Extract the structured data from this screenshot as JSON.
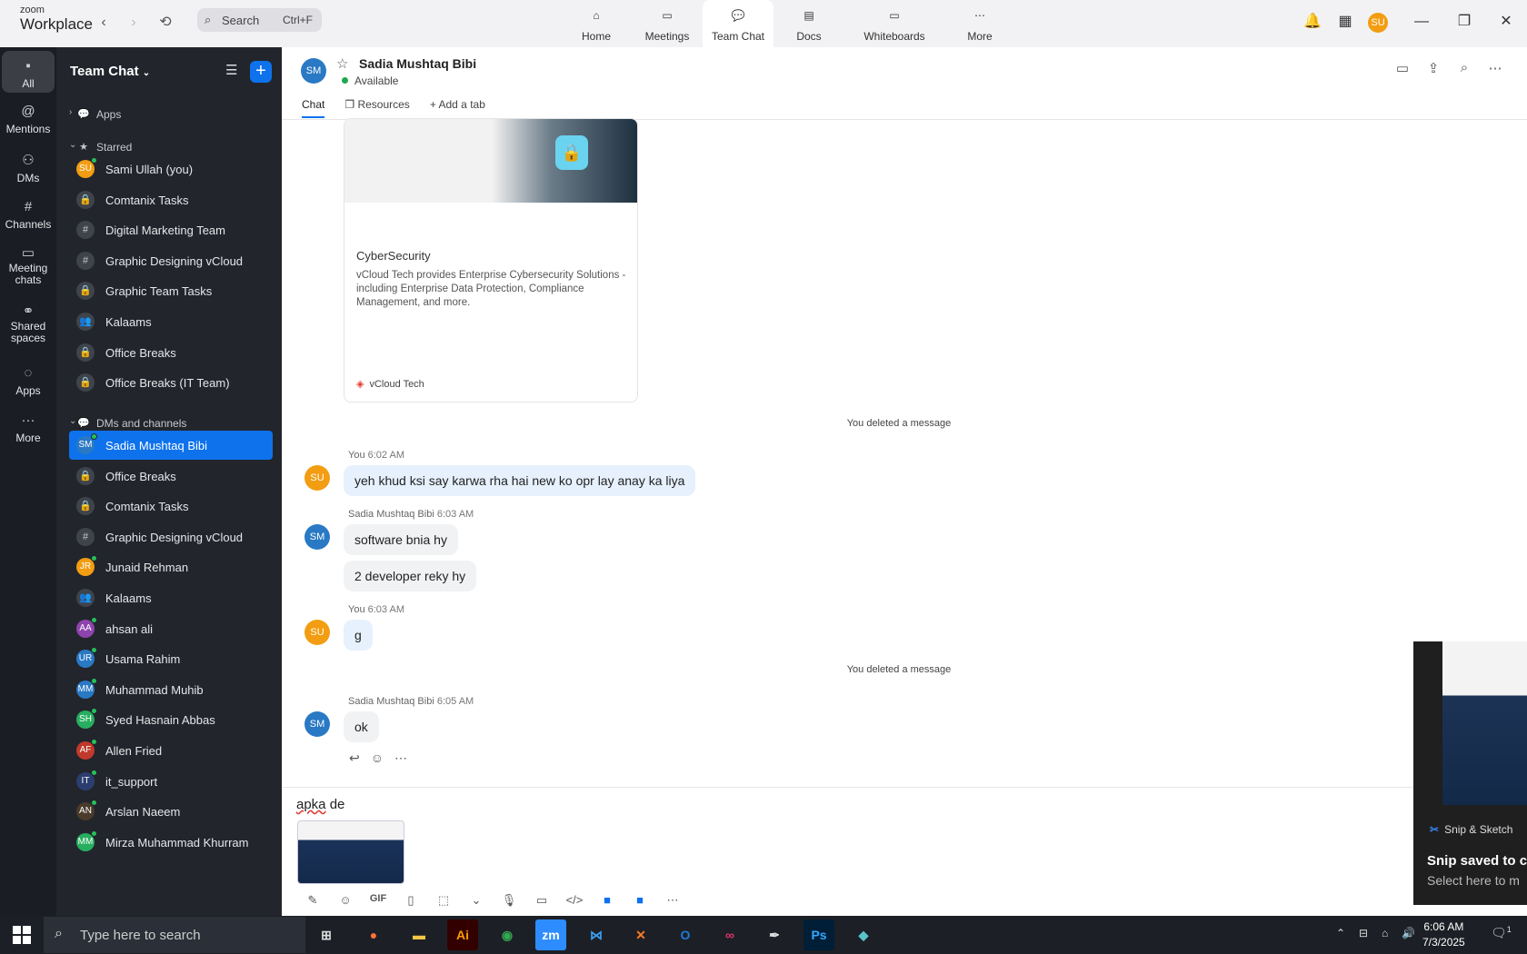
{
  "app": {
    "brand_small": "zoom",
    "brand_big": "Workplace"
  },
  "topbar": {
    "search_label": "Search",
    "search_shortcut": "Ctrl+F",
    "nav": [
      {
        "label": "Home"
      },
      {
        "label": "Meetings"
      },
      {
        "label": "Team Chat"
      },
      {
        "label": "Docs"
      },
      {
        "label": "Whiteboards"
      },
      {
        "label": "More"
      }
    ],
    "user_initials": "SU"
  },
  "leftnav": {
    "items": [
      {
        "label": "All"
      },
      {
        "label": "Mentions"
      },
      {
        "label": "DMs"
      },
      {
        "label": "Channels"
      },
      {
        "label": "Meeting chats"
      },
      {
        "label": "Shared spaces"
      },
      {
        "label": "Apps"
      },
      {
        "label": "More"
      }
    ]
  },
  "sidebar": {
    "title": "Team Chat",
    "apps_label": "Apps",
    "starred_label": "Starred",
    "starred": [
      {
        "label": "Sami Ullah (you)",
        "initials": "SU",
        "color": "#f29d12"
      },
      {
        "label": "Comtanix Tasks",
        "initials": "🔒"
      },
      {
        "label": "Digital Marketing Team",
        "initials": "#"
      },
      {
        "label": "Graphic Designing vCloud",
        "initials": "#"
      },
      {
        "label": "Graphic Team Tasks",
        "initials": "🔒"
      },
      {
        "label": "Kalaams",
        "initials": "👥"
      },
      {
        "label": "Office Breaks",
        "initials": "🔒"
      },
      {
        "label": "Office Breaks (IT Team)",
        "initials": "🔒"
      }
    ],
    "dms_label": "DMs and channels",
    "dms": [
      {
        "label": "Sadia Mushtaq Bibi",
        "initials": "SM",
        "color": "#2979c4"
      },
      {
        "label": "Office Breaks",
        "initials": "🔒"
      },
      {
        "label": "Comtanix Tasks",
        "initials": "🔒"
      },
      {
        "label": "Graphic Designing vCloud",
        "initials": "#"
      },
      {
        "label": "Junaid Rehman",
        "initials": "JR",
        "color": "#f29d12"
      },
      {
        "label": "Kalaams",
        "initials": "👥"
      },
      {
        "label": "ahsan ali",
        "initials": "AA",
        "color": "#8e44ad"
      },
      {
        "label": "Usama Rahim",
        "initials": "UR",
        "color": "#2979c4"
      },
      {
        "label": "Muhammad Muhib",
        "initials": "MM",
        "color": "#2979c4"
      },
      {
        "label": "Syed Hasnain Abbas",
        "initials": "SH",
        "color": "#27ae60"
      },
      {
        "label": "Allen Fried",
        "initials": "AF",
        "color": "#c0392b"
      },
      {
        "label": "it_support",
        "initials": "IT",
        "color": "#2c3e70"
      },
      {
        "label": "Arslan Naeem",
        "initials": "AN",
        "color": "#4a3b2a"
      },
      {
        "label": "Mirza Muhammad Khurram",
        "initials": "MM",
        "color": "#27ae60"
      }
    ]
  },
  "chat": {
    "contact_name": "Sadia Mushtaq Bibi",
    "contact_initials": "SM",
    "status": "Available",
    "tabs": [
      {
        "label": "Chat"
      },
      {
        "label": "Resources"
      },
      {
        "label": "Add a tab"
      }
    ],
    "card": {
      "title": "CyberSecurity",
      "description": "vCloud Tech provides Enterprise Cybersecurity Solutions - including Enterprise Data Protection, Compliance Management, and more.",
      "source": "vCloud Tech"
    },
    "deleted_text": "You deleted a message",
    "messages": [
      {
        "sender": "You",
        "time": "6:02 AM",
        "initials": "SU",
        "text": "yeh khud ksi say karwa rha hai new ko opr lay anay ka liya"
      },
      {
        "sender": "Sadia Mushtaq Bibi",
        "time": "6:03 AM",
        "initials": "SM",
        "text": "software bnia hy",
        "text2": "2 developer reky hy"
      },
      {
        "sender": "You",
        "time": "6:03 AM",
        "initials": "SU",
        "text": "g"
      },
      {
        "sender": "Sadia Mushtaq Bibi",
        "time": "6:05 AM",
        "initials": "SM",
        "text": "ok"
      }
    ],
    "composer_text_misspelled": "apka",
    "composer_text_rest": " de",
    "composer_tools": {
      "gif": "GIF"
    }
  },
  "snip": {
    "app": "Snip & Sketch",
    "heading": "Snip saved to cli",
    "body": "Select here to m"
  },
  "taskbar": {
    "search_placeholder": "Type here to search",
    "time": "6:06 AM",
    "date": "7/3/2025",
    "notif_count": "1"
  }
}
